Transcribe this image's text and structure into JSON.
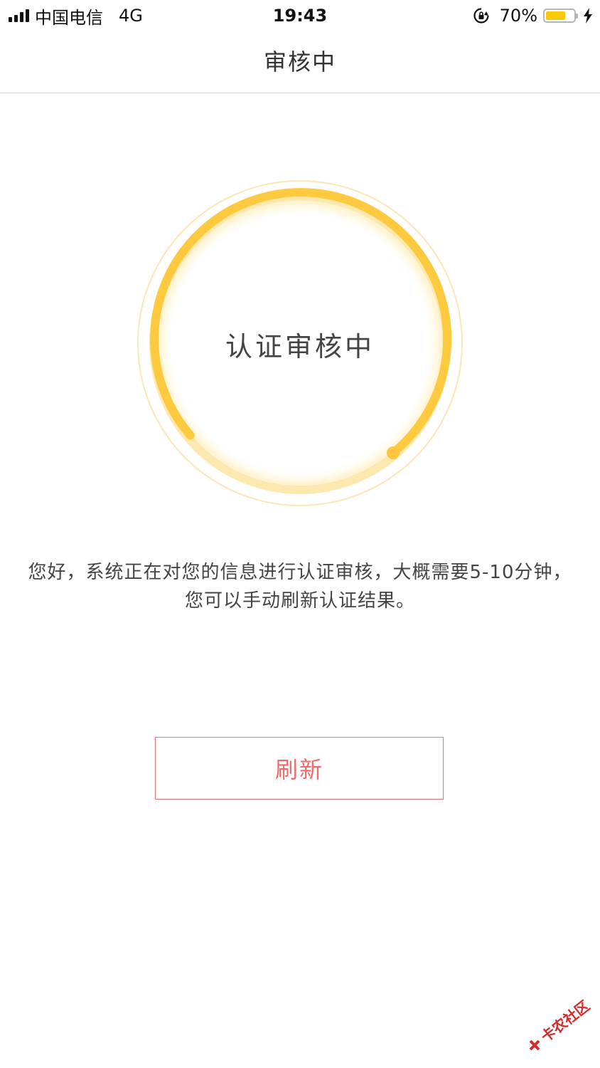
{
  "status_bar": {
    "carrier": "中国电信",
    "network": "4G",
    "time": "19:43",
    "battery_percent": "70%",
    "battery_level": 0.7,
    "colors": {
      "battery_fill": "#fcc80a"
    },
    "icons": [
      "signal-icon",
      "orientation-lock-icon",
      "battery-icon",
      "charging-bolt-icon"
    ]
  },
  "nav": {
    "title": "审核中"
  },
  "status_ring": {
    "label": "认证审核中",
    "colors": {
      "arc": "#fcc93f",
      "track": "#fde8b0",
      "outer": "#fbe6b8"
    }
  },
  "message": "您好，系统正在对您的信息进行认证审核，大概需要5-10分钟，您可以手动刷新认证结果。",
  "refresh_button": {
    "label": "刷新",
    "colors": {
      "border": "#e9707a",
      "text": "#f06a6a"
    }
  },
  "watermark": {
    "text": "卡农社区"
  }
}
